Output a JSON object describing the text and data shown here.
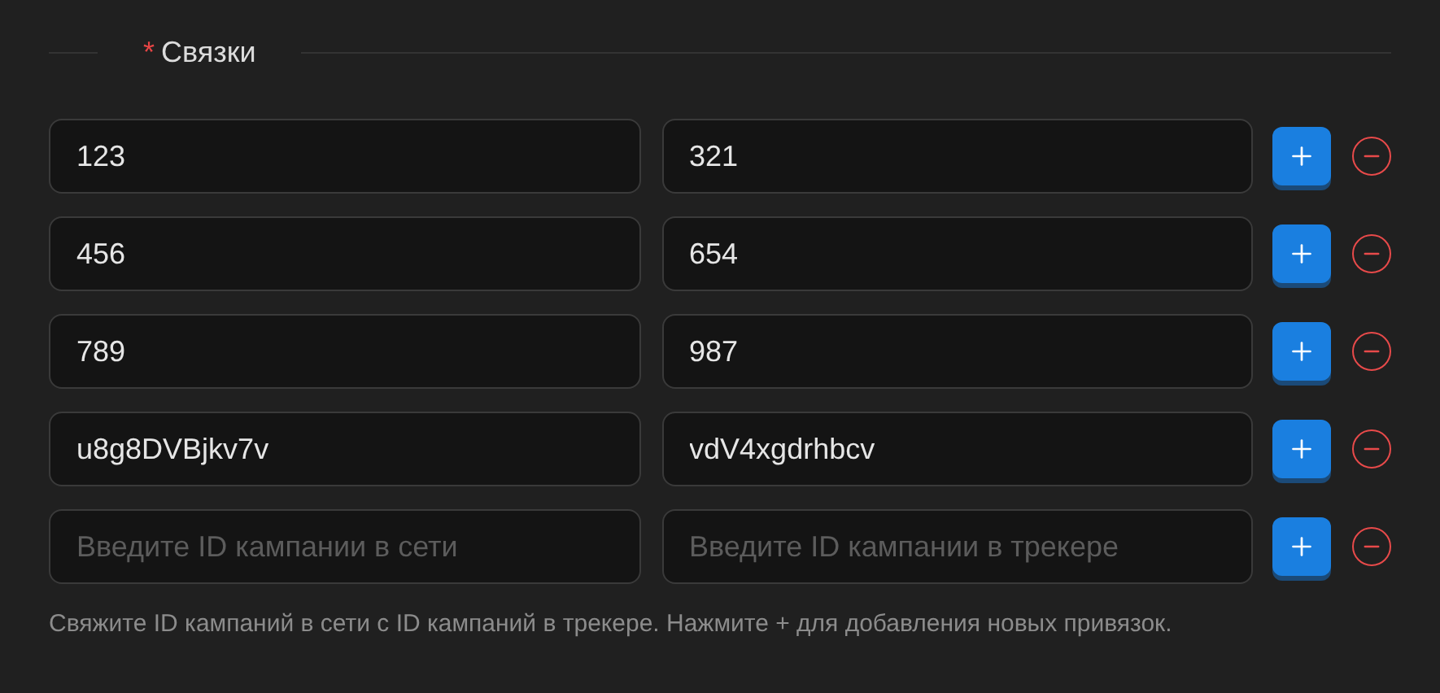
{
  "section": {
    "title": "Связки",
    "required_mark": "*"
  },
  "rows": [
    {
      "network": {
        "value": "123"
      },
      "tracker": {
        "value": "321"
      }
    },
    {
      "network": {
        "value": "456"
      },
      "tracker": {
        "value": "654"
      }
    },
    {
      "network": {
        "value": "789"
      },
      "tracker": {
        "value": "987"
      }
    },
    {
      "network": {
        "value": "u8g8DVBjkv7v"
      },
      "tracker": {
        "value": "vdV4xgdrhbcv"
      }
    },
    {
      "network": {
        "placeholder": "Введите ID кампании в сети"
      },
      "tracker": {
        "placeholder": "Введите ID кампании в трекере"
      }
    }
  ],
  "hint": "Свяжите ID кампаний в сети с ID кампаний в трекере. Нажмите + для добавления новых привязок."
}
